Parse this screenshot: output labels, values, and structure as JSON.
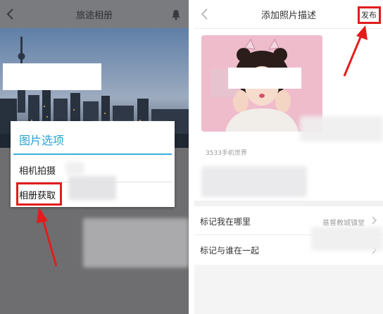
{
  "left_screen": {
    "nav_title": "旅途相册",
    "dialog": {
      "title": "图片选项",
      "options": [
        {
          "label": "相机拍摄"
        },
        {
          "label": "相册获取"
        }
      ]
    }
  },
  "right_screen": {
    "nav_title": "添加照片描述",
    "publish_label": "发布",
    "watermark_text": "3533手机世界",
    "rows": {
      "location_label": "标记我在哪里",
      "location_value": "基督教城镇堂",
      "tag_label": "标记与谁在一起"
    }
  },
  "colors": {
    "accent_blue": "#2aa2d2",
    "highlight_red": "#e21c1c",
    "photo_pink": "#f2c2cf"
  },
  "icons": [
    "back-chevron-icon",
    "bell-icon",
    "chevron-right-icon",
    "arrow-annotation"
  ]
}
